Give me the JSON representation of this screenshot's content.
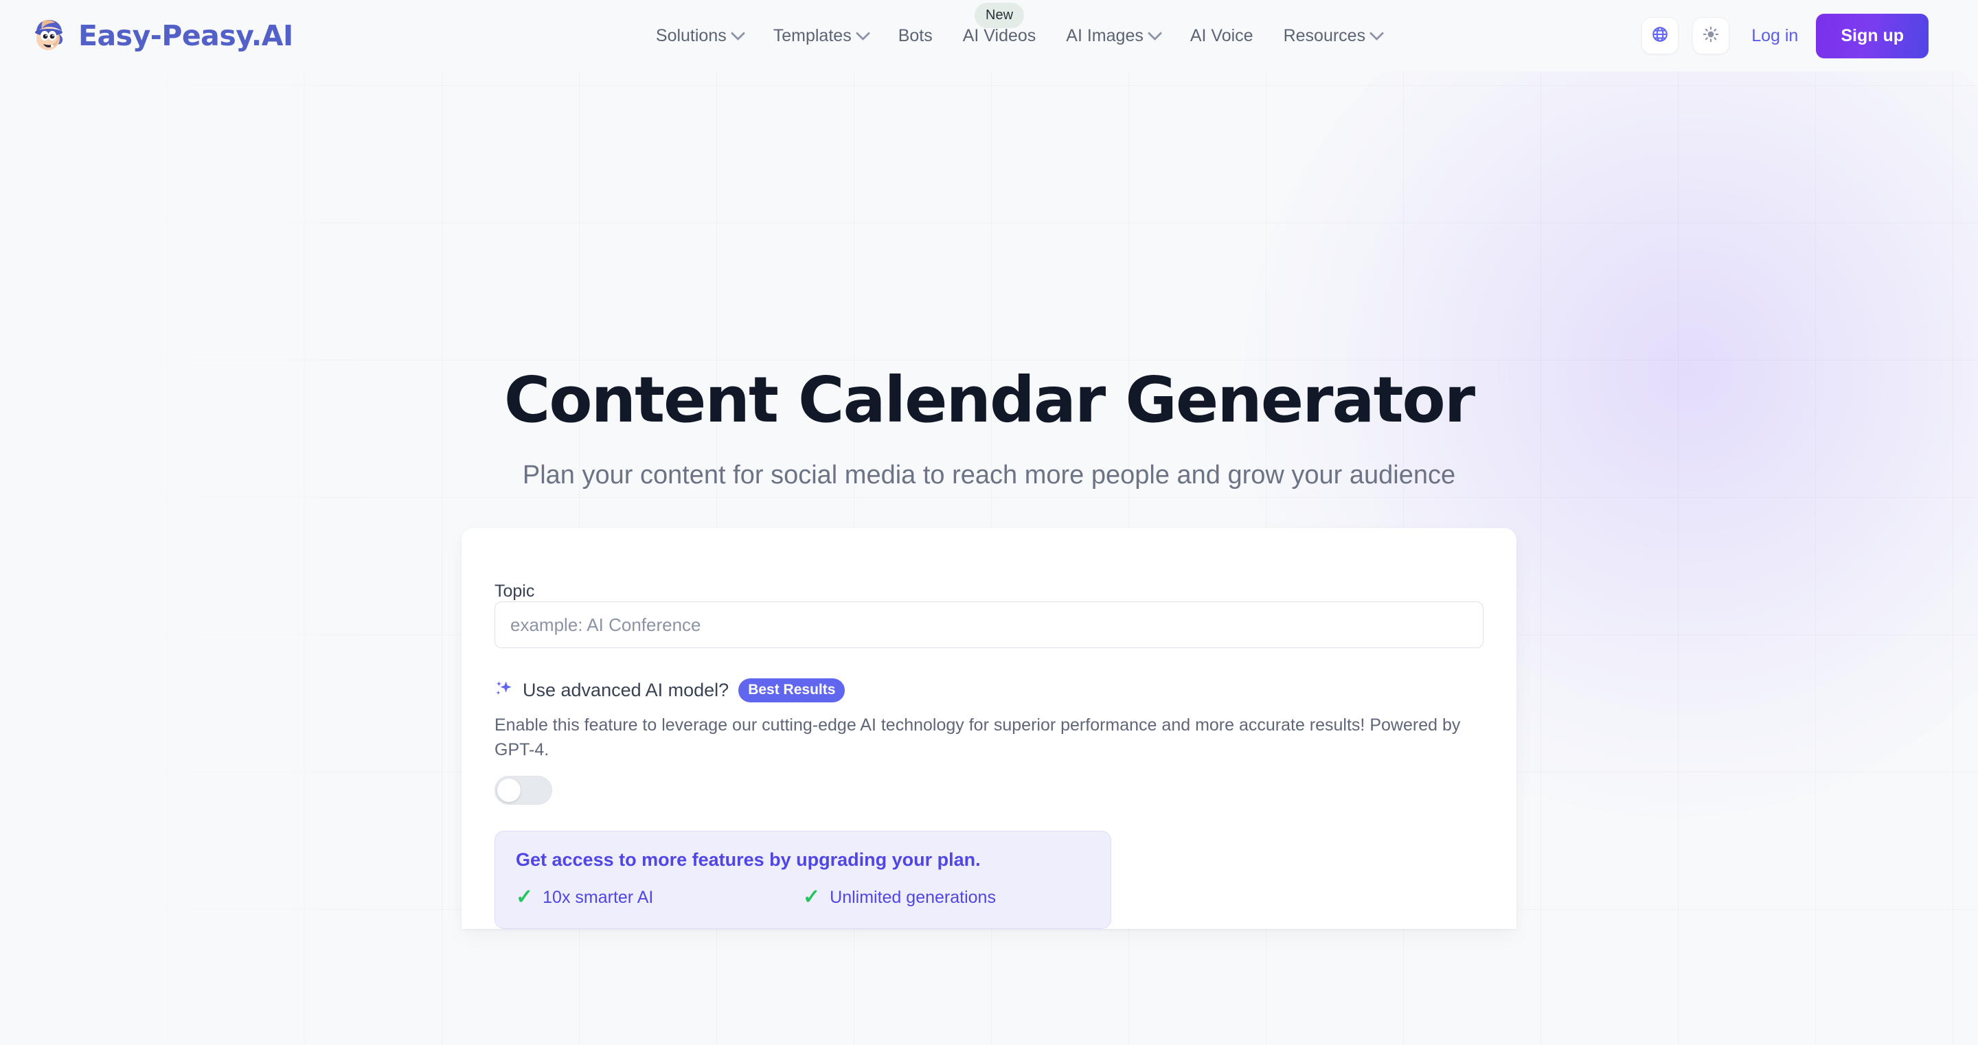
{
  "brand": {
    "name": "Easy-Peasy.AI",
    "logo_icon": "mascot-avatar-icon",
    "color": "#5260c8"
  },
  "nav": {
    "items": [
      {
        "label": "Solutions",
        "has_dropdown": true,
        "badge": null
      },
      {
        "label": "Templates",
        "has_dropdown": true,
        "badge": null
      },
      {
        "label": "Bots",
        "has_dropdown": false,
        "badge": null
      },
      {
        "label": "AI Videos",
        "has_dropdown": false,
        "badge": "New"
      },
      {
        "label": "AI Images",
        "has_dropdown": true,
        "badge": null
      },
      {
        "label": "AI Voice",
        "has_dropdown": false,
        "badge": null
      },
      {
        "label": "Resources",
        "has_dropdown": true,
        "badge": null
      }
    ]
  },
  "header_actions": {
    "language_icon": "globe-icon",
    "theme_icon": "sun-icon",
    "login_label": "Log in",
    "signup_label": "Sign up",
    "signup_gradient_from": "#7b30ea",
    "signup_gradient_to": "#4f46e5",
    "login_color": "#5b5ce6"
  },
  "hero": {
    "title": "Content Calendar Generator",
    "subtitle": "Plan your content for social media to reach more people and grow your audience"
  },
  "form": {
    "topic": {
      "label": "Topic",
      "placeholder": "example: AI Conference",
      "value": ""
    },
    "advanced": {
      "icon": "sparkles-icon",
      "label": "Use advanced AI model?",
      "badge": "Best Results",
      "badge_color": "#6166ef",
      "description": "Enable this feature to leverage our cutting-edge AI technology for superior performance and more accurate results! Powered by GPT-4.",
      "toggle_state": "off"
    }
  },
  "upgrade": {
    "title": "Get access to more features by upgrading your plan.",
    "accent_color": "#4f46e5",
    "check_color": "#22c55e",
    "features": [
      "10x smarter AI",
      "Unlimited generations"
    ]
  }
}
